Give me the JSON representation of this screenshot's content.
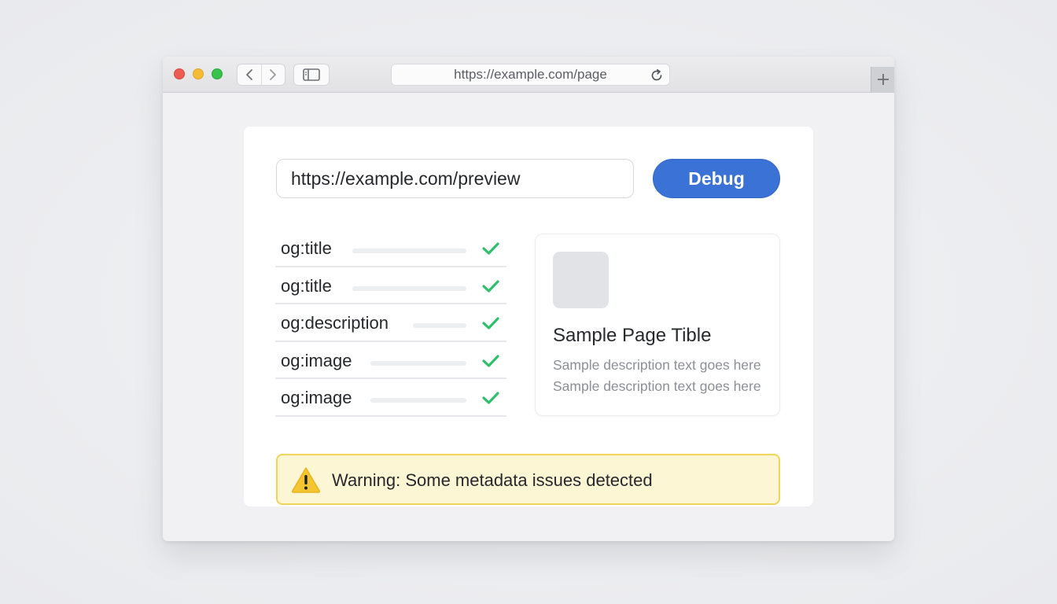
{
  "browser": {
    "address": "https://example.com/page",
    "icons": {
      "back": "chevron-left-icon",
      "forward": "chevron-right-icon",
      "sidebar": "sidebar-icon",
      "reload": "reload-icon",
      "new_tab": "plus-icon"
    }
  },
  "debugger": {
    "url_value": "https://example.com/preview",
    "debug_label": "Debug",
    "accent_color": "#3b72d6"
  },
  "meta_tags": [
    {
      "label": "og:title",
      "status": "check-icon"
    },
    {
      "label": "og:title",
      "status": "check-icon"
    },
    {
      "label": "og:description",
      "status": "check-icon"
    },
    {
      "label": "og:image",
      "status": "check-icon"
    },
    {
      "label": "og:image",
      "status": "check-icon"
    }
  ],
  "preview": {
    "title": "Sample Page Tible",
    "description_lines": [
      "Sample description text goes here",
      "Sample description text goes here"
    ]
  },
  "warning": {
    "text": "Warning: Some metadata issues detected",
    "icon": "warning-icon",
    "color": "#f1d45a"
  },
  "colors": {
    "check": "#2fbf6b"
  }
}
